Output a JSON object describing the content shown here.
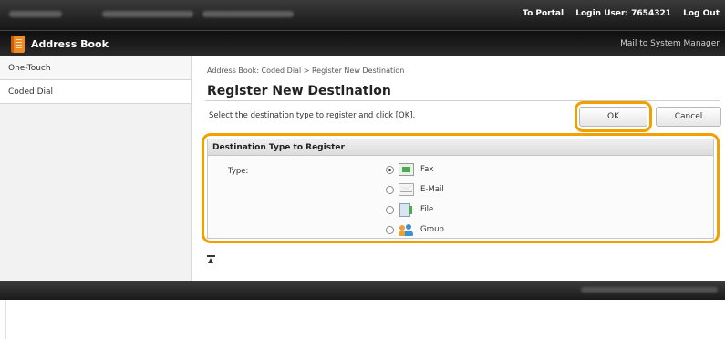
{
  "topbar": {
    "to_portal": "To Portal",
    "login_user": "Login User: 7654321",
    "log_out": "Log Out"
  },
  "header": {
    "title": "Address Book",
    "mail_to": "Mail to System Manager",
    "icon": "address-book-icon"
  },
  "sidebar": {
    "items": [
      {
        "label": "One-Touch"
      },
      {
        "label": "Coded Dial"
      }
    ]
  },
  "main": {
    "breadcrumb": "Address Book: Coded Dial > Register New Destination",
    "title": "Register New Destination",
    "instruction": "Select the destination type to register and click [OK].",
    "ok_label": "OK",
    "cancel_label": "Cancel",
    "section_title": "Destination Type to Register",
    "type_label": "Type:",
    "options": [
      {
        "label": "Fax",
        "icon": "fax-icon",
        "checked": true
      },
      {
        "label": "E-Mail",
        "icon": "email-icon",
        "checked": false
      },
      {
        "label": "File",
        "icon": "file-icon",
        "checked": false
      },
      {
        "label": "Group",
        "icon": "group-icon",
        "checked": false
      }
    ]
  },
  "colors": {
    "highlight": "#f2a000",
    "header_bg": "#161616",
    "accent_icon": "#f08a24"
  }
}
